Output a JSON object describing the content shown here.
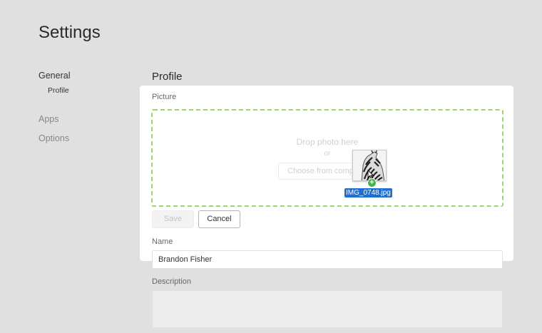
{
  "page": {
    "title": "Settings"
  },
  "nav": {
    "general": "General",
    "profile": "Profile",
    "apps": "Apps",
    "options": "Options"
  },
  "profile": {
    "section_title": "Profile",
    "picture_label": "Picture",
    "dropzone": {
      "main_text": "Drop photo here",
      "or_text": "or",
      "choose_label": "Choose from computer"
    },
    "drag": {
      "file_name": "IMG_0748.jpg",
      "thumbnail_icon": "zebra-photo-thumbnail",
      "badge_icon": "plus-icon",
      "cursor_icon": "arrow-cursor-icon"
    },
    "save_label": "Save",
    "cancel_label": "Cancel",
    "name_label": "Name",
    "name_value": "Brandon Fisher",
    "description_label": "Description",
    "description_value": ""
  },
  "colors": {
    "dropzone_border": "#9fd36f",
    "file_label_bg": "#1f6fd1",
    "badge": "#4caf50",
    "overlay": "#e0e0e0"
  }
}
